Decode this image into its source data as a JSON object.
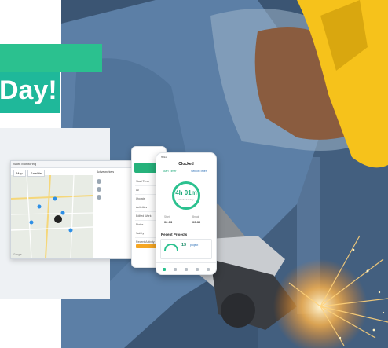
{
  "banner": {
    "headline": "Day!"
  },
  "laptop": {
    "window_title": "Work Monitoring",
    "tabs": [
      "Map",
      "Satellite"
    ],
    "map_attribution": "Google",
    "sidebar_rows": [
      "Active workers",
      "Active workers"
    ]
  },
  "phone_left": {
    "menu_items": [
      "Start Timer",
      "All",
      "Update",
      "Activities",
      "Edited Work",
      "Notes",
      "Safety",
      "Recent Activity"
    ]
  },
  "phone_right": {
    "status_time": "9:41",
    "title": "Clocked",
    "tab_active": "Start Timer",
    "tab_other": "Select Timer",
    "timer_value": "4h 01m",
    "timer_caption": "Clocked today",
    "stats": [
      {
        "label": "Start",
        "value": "02:13"
      },
      {
        "label": "Break",
        "value": "00:30"
      }
    ],
    "recent_title": "Recent Projects",
    "project_amount": "13",
    "project_unit": "project"
  },
  "colors": {
    "brand_green": "#2bc18f",
    "teal": "#1fb89a",
    "accent_orange": "#f5a623",
    "helmet_yellow": "#f6c21b"
  }
}
